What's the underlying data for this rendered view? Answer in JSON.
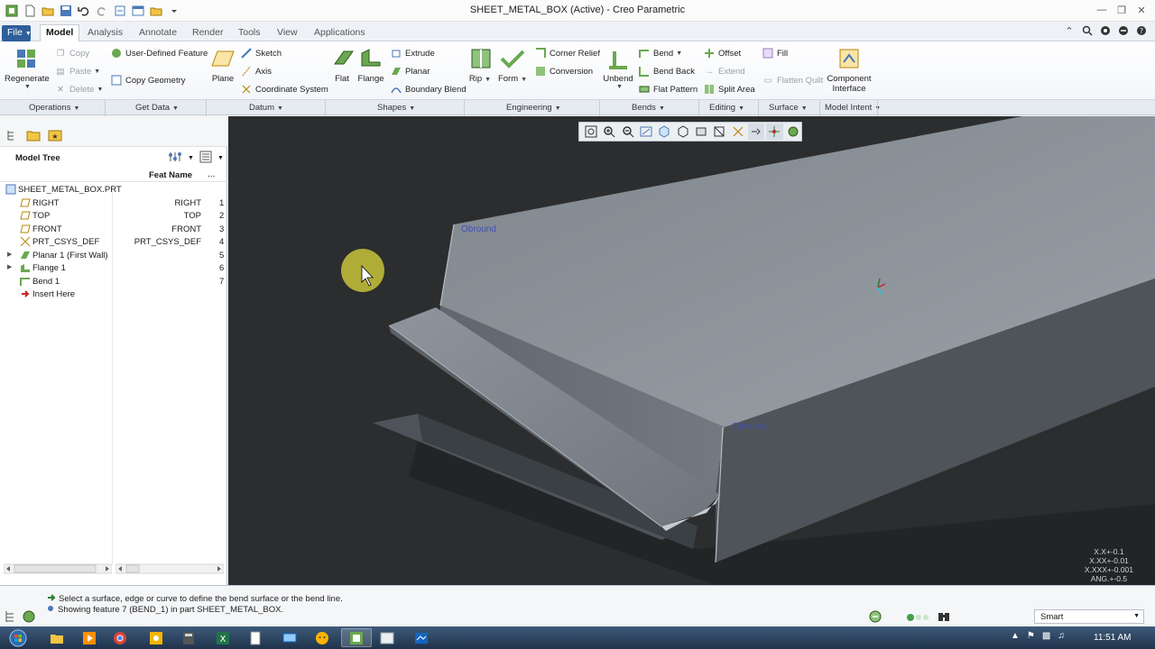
{
  "window": {
    "title": "SHEET_METAL_BOX (Active) - Creo Parametric"
  },
  "tabs": {
    "file": "File",
    "items": [
      "Model",
      "Analysis",
      "Annotate",
      "Render",
      "Tools",
      "View",
      "Applications"
    ]
  },
  "ribbon": {
    "regenerate": "Regenerate",
    "copy": "Copy",
    "paste": "Paste",
    "delete": "Delete",
    "user_defined_feature": "User-Defined Feature",
    "copy_geometry": "Copy Geometry",
    "plane": "Plane",
    "sketch": "Sketch",
    "axis": "Axis",
    "coordinate_system": "Coordinate System",
    "flat": "Flat",
    "flange": "Flange",
    "extrude": "Extrude",
    "planar": "Planar",
    "boundary_blend": "Boundary Blend",
    "rip": "Rip",
    "form": "Form",
    "corner_relief": "Corner Relief",
    "conversion": "Conversion",
    "unbend": "Unbend",
    "bend": "Bend",
    "bend_back": "Bend Back",
    "flat_pattern": "Flat Pattern",
    "offset": "Offset",
    "extend": "Extend",
    "split_area": "Split Area",
    "fill": "Fill",
    "flatten_quilt": "Flatten Quilt",
    "component_interface_1": "Component",
    "component_interface_2": "Interface"
  },
  "groups": [
    "Operations",
    "Get Data",
    "Datum",
    "Shapes",
    "Engineering",
    "Bends",
    "Editing",
    "Surface",
    "Model Intent"
  ],
  "model_tree": {
    "title": "Model Tree",
    "column_header": "Feat Name",
    "column_more": "...",
    "rows": [
      {
        "label": "SHEET_METAL_BOX.PRT",
        "feat": "",
        "num": ""
      },
      {
        "label": "RIGHT",
        "feat": "RIGHT",
        "num": "1"
      },
      {
        "label": "TOP",
        "feat": "TOP",
        "num": "2"
      },
      {
        "label": "FRONT",
        "feat": "FRONT",
        "num": "3"
      },
      {
        "label": "PRT_CSYS_DEF",
        "feat": "PRT_CSYS_DEF",
        "num": "4"
      },
      {
        "label": "Planar 1 (First Wall)",
        "feat": "",
        "num": "5"
      },
      {
        "label": "Flange 1",
        "feat": "",
        "num": "6"
      },
      {
        "label": "Bend 1",
        "feat": "",
        "num": "7"
      },
      {
        "label": "Insert Here",
        "feat": "",
        "num": ""
      }
    ]
  },
  "viewport": {
    "annotation_1": "Obround",
    "annotation_2": "Obround",
    "tolerance": [
      "X.X+-0.1",
      "X.XX+-0.01",
      "X.XXX+-0.001",
      "ANG.+-0.5"
    ]
  },
  "status": {
    "message_1": "Select a surface, edge or curve to define the bend surface or the bend line.",
    "message_2": "Showing feature 7 (BEND_1) in part SHEET_METAL_BOX.",
    "filter": "Smart"
  },
  "taskbar": {
    "time": "11:51 AM"
  },
  "colors": {
    "accent": "#2f5f9b",
    "viewport_bg": "#2b2d2f",
    "model_surface": "#8a9096"
  }
}
